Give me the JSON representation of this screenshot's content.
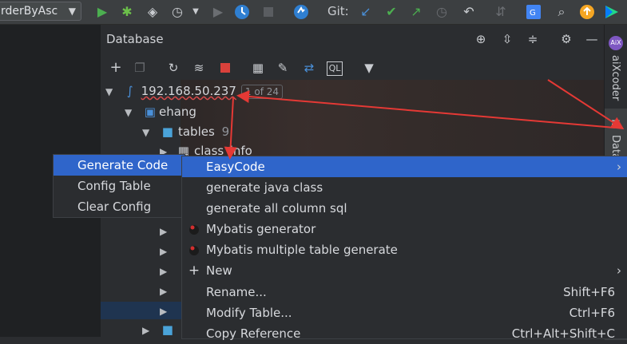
{
  "toolbar": {
    "run_config": "rderByAsc",
    "git_label": "Git:",
    "icons": [
      "run-icon",
      "debug-icon",
      "coverage-icon",
      "profile-icon",
      "run-dropdown-icon",
      "resume-icon",
      "attach-icon",
      "stop-icon",
      "update-icon",
      "git-fetch-icon",
      "git-commit-icon",
      "git-push-icon",
      "git-history-icon",
      "git-rollback-icon",
      "merge-icon",
      "translate-icon",
      "search-icon",
      "update-available-icon",
      "toolbox-icon"
    ]
  },
  "panel": {
    "title": "Database",
    "header_icons": [
      "target-icon",
      "expand-all-icon",
      "collapse-all-icon",
      "gear-icon",
      "minimize-icon"
    ],
    "toolbar_icons": [
      "add-icon",
      "duplicate-icon",
      "refresh-icon",
      "schema-sync-icon",
      "stop-icon",
      "table-icon",
      "edit-icon",
      "jump-icon",
      "query-console-icon",
      "filter-icon"
    ]
  },
  "right_strip": {
    "aix_label": "aiXcoder",
    "db_label": "Datab"
  },
  "tree": {
    "host": "192.168.50.237",
    "host_count": "1 of 24",
    "schema": "ehang",
    "tables_label": "tables",
    "tables_count": "9",
    "first_table": "class_info"
  },
  "left_menu": {
    "items": [
      "Generate Code",
      "Config Table",
      "Clear Config"
    ]
  },
  "main_menu": {
    "items": [
      {
        "label": "EasyCode",
        "shortcut": "",
        "submenu": true
      },
      {
        "label": "generate java class",
        "shortcut": "",
        "submenu": false
      },
      {
        "label": "generate all column sql",
        "shortcut": "",
        "submenu": false
      },
      {
        "label": "Mybatis generator",
        "shortcut": "",
        "submenu": false
      },
      {
        "label": "Mybatis multiple table generate",
        "shortcut": "",
        "submenu": false
      },
      {
        "label": "New",
        "shortcut": "",
        "submenu": true
      },
      {
        "label": "Rename...",
        "shortcut": "Shift+F6",
        "submenu": false
      },
      {
        "label": "Modify Table...",
        "shortcut": "Ctrl+F6",
        "submenu": false
      },
      {
        "label": "Copy Reference",
        "shortcut": "Ctrl+Alt+Shift+C",
        "submenu": false
      }
    ]
  },
  "colors": {
    "selection": "#2f65ca",
    "annotation_arrow": "#e53935",
    "run_green": "#4caf50"
  }
}
